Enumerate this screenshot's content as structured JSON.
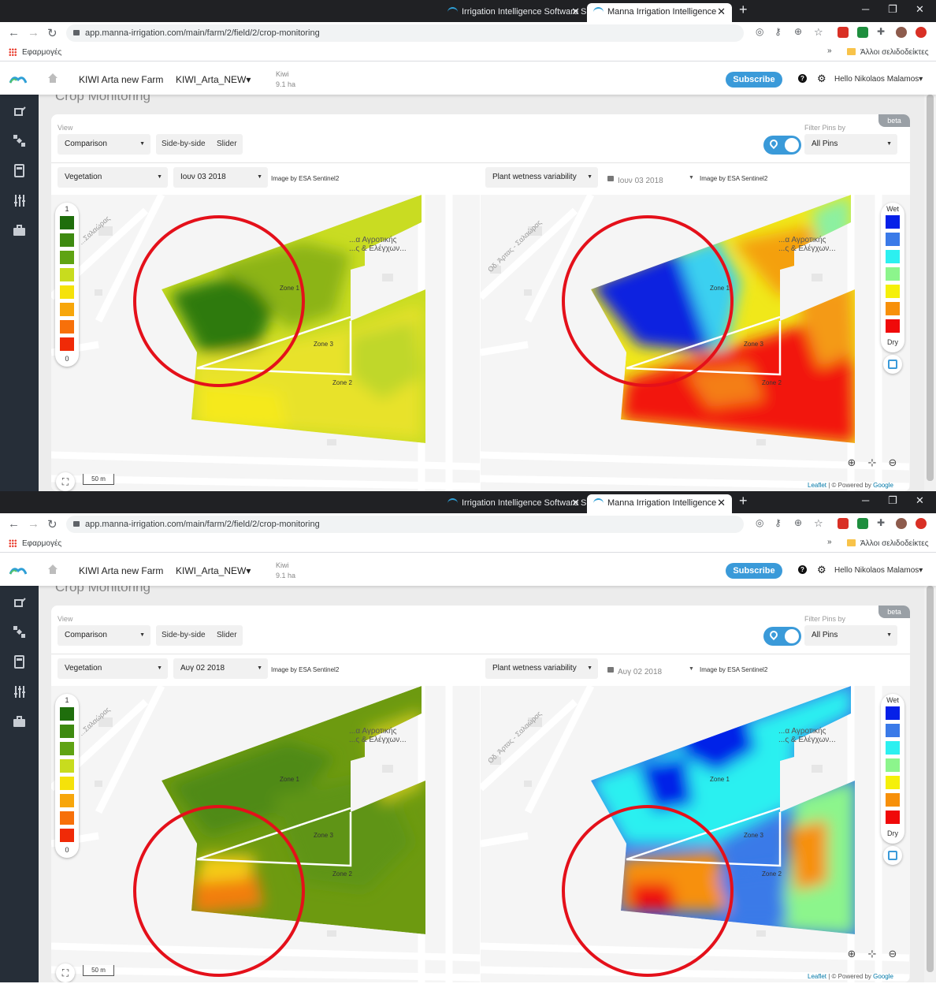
{
  "browser": {
    "tabs": [
      {
        "title": "Irrigation Intelligence Software S",
        "active": false
      },
      {
        "title": "Manna Irrigation Intelligence",
        "active": true
      }
    ],
    "url": "app.manna-irrigation.com/main/farm/2/field/2/crop-monitoring",
    "bookmarks": {
      "apps": "Εφαρμογές",
      "other": "Άλλοι σελιδοδείκτες"
    }
  },
  "app": {
    "farm": "KIWI Arta new Farm",
    "field": "KIWI_Arta_NEW",
    "crop": "Kiwi",
    "area": "9.1 ha",
    "subscribe": "Subscribe",
    "user": "Hello Nikolaos Malamos",
    "page_title": "Crop Monitoring",
    "beta": "beta"
  },
  "controls": {
    "view_label": "View",
    "view_value": "Comparison",
    "side_by_side": "Side-by-side",
    "slider": "Slider",
    "filter_label": "Filter Pins by",
    "filter_value": "All Pins",
    "left_layer": "Vegetation",
    "right_layer": "Plant wetness variability",
    "image_by": "Image by ESA Sentinel2"
  },
  "legend": {
    "veg_top": "1",
    "veg_bottom": "0",
    "veg_colors": [
      "#1f6e0c",
      "#3e8a10",
      "#5fa313",
      "#c8dc1e",
      "#f5e20a",
      "#f7a60b",
      "#f7700a",
      "#f02a07"
    ],
    "wet_top": "Wet",
    "wet_bottom": "Dry",
    "wet_colors": [
      "#0620e8",
      "#3a7ae8",
      "#2cf0f0",
      "#8cf58c",
      "#f5f00a",
      "#f7900a",
      "#f00a0a"
    ]
  },
  "map": {
    "zones": [
      "Zone 1",
      "Zone 3",
      "Zone 2"
    ],
    "poi": "...α Αγροτικής\n...ς & Ελέγχων...",
    "road_left": "...Σαλαώρας",
    "road_right": "Οδ. Άρτας - Σαλαώρας",
    "scale": "50 m",
    "attribution_leaflet": "Leaflet",
    "attribution_rest": " | © Powered by ",
    "attribution_google": "Google"
  },
  "screenshots": [
    {
      "date": "Ιουν 03 2018"
    },
    {
      "date": "Αυγ 02 2018"
    }
  ]
}
